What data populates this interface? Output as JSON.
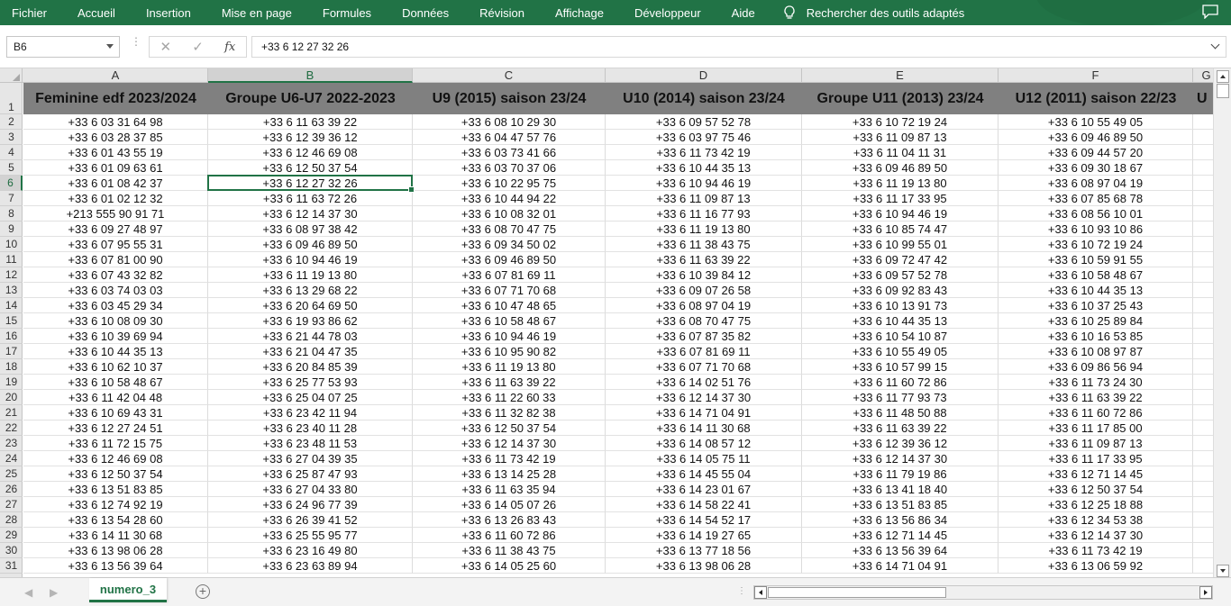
{
  "ribbon": {
    "tabs": [
      "Fichier",
      "Accueil",
      "Insertion",
      "Mise en page",
      "Formules",
      "Données",
      "Révision",
      "Affichage",
      "Développeur",
      "Aide"
    ],
    "search_label": "Rechercher des outils adaptés",
    "search_icon": "lightbulb-icon",
    "comment_icon": "comment-icon"
  },
  "formula_bar": {
    "name_box": "B6",
    "formula": "+33 6 12 27 32 26",
    "fx_label": "fx",
    "cancel_glyph": "✕",
    "enter_glyph": "✓"
  },
  "grid": {
    "column_letters": [
      "A",
      "B",
      "C",
      "D",
      "E",
      "F",
      "G"
    ],
    "selected_column": "B",
    "selected_row": 6,
    "row_numbers": [
      1,
      2,
      3,
      4,
      5,
      6,
      7,
      8,
      9,
      10,
      11,
      12,
      13,
      14,
      15,
      16,
      17,
      18,
      19,
      20,
      21,
      22,
      23,
      24,
      25,
      26,
      27,
      28,
      29,
      30,
      31
    ],
    "headers": [
      "Feminine edf 2023/2024",
      "Groupe U6-U7 2022-2023",
      "U9 (2015) saison 23/24",
      "U10 (2014) saison 23/24",
      "Groupe U11 (2013) 23/24",
      "U12 (2011) saison 22/23",
      "U"
    ],
    "rows": [
      [
        "+33 6 03 31 64 98",
        "+33 6 11 63 39 22",
        "+33 6 08 10 29 30",
        "+33 6 09 57 52 78",
        "+33 6 10 72 19 24",
        "+33 6 10 55 49 05"
      ],
      [
        "+33 6 03 28 37 85",
        "+33 6 12 39 36 12",
        "+33 6 04 47 57 76",
        "+33 6 03 97 75 46",
        "+33 6 11 09 87 13",
        "+33 6 09 46 89 50"
      ],
      [
        "+33 6 01 43 55 19",
        "+33 6 12 46 69 08",
        "+33 6 03 73 41 66",
        "+33 6 11 73 42 19",
        "+33 6 11 04 11 31",
        "+33 6 09 44 57 20"
      ],
      [
        "+33 6 01 09 63 61",
        "+33 6 12 50 37 54",
        "+33 6 03 70 37 06",
        "+33 6 10 44 35 13",
        "+33 6 09 46 89 50",
        "+33 6 09 30 18 67"
      ],
      [
        "+33 6 01 08 42 37",
        "+33 6 12 27 32 26",
        "+33 6 10 22 95 75",
        "+33 6 10 94 46 19",
        "+33 6 11 19 13 80",
        "+33 6 08 97 04 19"
      ],
      [
        "+33 6 01 02 12 32",
        "+33 6 11 63 72 26",
        "+33 6 10 44 94 22",
        "+33 6 11 09 87 13",
        "+33 6 11 17 33 95",
        "+33 6 07 85 68 78"
      ],
      [
        "+213 555 90 91 71",
        "+33 6 12 14 37 30",
        "+33 6 10 08 32 01",
        "+33 6 11 16 77 93",
        "+33 6 10 94 46 19",
        "+33 6 08 56 10 01"
      ],
      [
        "+33 6 09 27 48 97",
        "+33 6 08 97 38 42",
        "+33 6 08 70 47 75",
        "+33 6 11 19 13 80",
        "+33 6 10 85 74 47",
        "+33 6 10 93 10 86"
      ],
      [
        "+33 6 07 95 55 31",
        "+33 6 09 46 89 50",
        "+33 6 09 34 50 02",
        "+33 6 11 38 43 75",
        "+33 6 10 99 55 01",
        "+33 6 10 72 19 24"
      ],
      [
        "+33 6 07 81 00 90",
        "+33 6 10 94 46 19",
        "+33 6 09 46 89 50",
        "+33 6 11 63 39 22",
        "+33 6 09 72 47 42",
        "+33 6 10 59 91 55"
      ],
      [
        "+33 6 07 43 32 82",
        "+33 6 11 19 13 80",
        "+33 6 07 81 69 11",
        "+33 6 10 39 84 12",
        "+33 6 09 57 52 78",
        "+33 6 10 58 48 67"
      ],
      [
        "+33 6 03 74 03 03",
        "+33 6 13 29 68 22",
        "+33 6 07 71 70 68",
        "+33 6 09 07 26 58",
        "+33 6 09 92 83 43",
        "+33 6 10 44 35 13"
      ],
      [
        "+33 6 03 45 29 34",
        "+33 6 20 64 69 50",
        "+33 6 10 47 48 65",
        "+33 6 08 97 04 19",
        "+33 6 10 13 91 73",
        "+33 6 10 37 25 43"
      ],
      [
        "+33 6 10 08 09 30",
        "+33 6 19 93 86 62",
        "+33 6 10 58 48 67",
        "+33 6 08 70 47 75",
        "+33 6 10 44 35 13",
        "+33 6 10 25 89 84"
      ],
      [
        "+33 6 10 39 69 94",
        "+33 6 21 44 78 03",
        "+33 6 10 94 46 19",
        "+33 6 07 87 35 82",
        "+33 6 10 54 10 87",
        "+33 6 10 16 53 85"
      ],
      [
        "+33 6 10 44 35 13",
        "+33 6 21 04 47 35",
        "+33 6 10 95 90 82",
        "+33 6 07 81 69 11",
        "+33 6 10 55 49 05",
        "+33 6 10 08 97 87"
      ],
      [
        "+33 6 10 62 10 37",
        "+33 6 20 84 85 39",
        "+33 6 11 19 13 80",
        "+33 6 07 71 70 68",
        "+33 6 10 57 99 15",
        "+33 6 09 86 56 94"
      ],
      [
        "+33 6 10 58 48 67",
        "+33 6 25 77 53 93",
        "+33 6 11 63 39 22",
        "+33 6 14 02 51 76",
        "+33 6 11 60 72 86",
        "+33 6 11 73 24 30"
      ],
      [
        "+33 6 11 42 04 48",
        "+33 6 25 04 07 25",
        "+33 6 11 22 60 33",
        "+33 6 12 14 37 30",
        "+33 6 11 77 93 73",
        "+33 6 11 63 39 22"
      ],
      [
        "+33 6 10 69 43 31",
        "+33 6 23 42 11 94",
        "+33 6 11 32 82 38",
        "+33 6 14 71 04 91",
        "+33 6 11 48 50 88",
        "+33 6 11 60 72 86"
      ],
      [
        "+33 6 12 27 24 51",
        "+33 6 23 40 11 28",
        "+33 6 12 50 37 54",
        "+33 6 14 11 30 68",
        "+33 6 11 63 39 22",
        "+33 6 11 17 85 00"
      ],
      [
        "+33 6 11 72 15 75",
        "+33 6 23 48 11 53",
        "+33 6 12 14 37 30",
        "+33 6 14 08 57 12",
        "+33 6 12 39 36 12",
        "+33 6 11 09 87 13"
      ],
      [
        "+33 6 12 46 69 08",
        "+33 6 27 04 39 35",
        "+33 6 11 73 42 19",
        "+33 6 14 05 75 11",
        "+33 6 12 14 37 30",
        "+33 6 11 17 33 95"
      ],
      [
        "+33 6 12 50 37 54",
        "+33 6 25 87 47 93",
        "+33 6 13 14 25 28",
        "+33 6 14 45 55 04",
        "+33 6 11 79 19 86",
        "+33 6 12 71 14 45"
      ],
      [
        "+33 6 13 51 83 85",
        "+33 6 27 04 33 80",
        "+33 6 11 63 35 94",
        "+33 6 14 23 01 67",
        "+33 6 13 41 18 40",
        "+33 6 12 50 37 54"
      ],
      [
        "+33 6 12 74 92 19",
        "+33 6 24 96 77 39",
        "+33 6 14 05 07 26",
        "+33 6 14 58 22 41",
        "+33 6 13 51 83 85",
        "+33 6 12 25 18 88"
      ],
      [
        "+33 6 13 54 28 60",
        "+33 6 26 39 41 52",
        "+33 6 13 26 83 43",
        "+33 6 14 54 52 17",
        "+33 6 13 56 86 34",
        "+33 6 12 34 53 38"
      ],
      [
        "+33 6 14 11 30 68",
        "+33 6 25 55 95 77",
        "+33 6 11 60 72 86",
        "+33 6 14 19 27 65",
        "+33 6 12 71 14 45",
        "+33 6 12 14 37 30"
      ],
      [
        "+33 6 13 98 06 28",
        "+33 6 23 16 49 80",
        "+33 6 11 38 43 75",
        "+33 6 13 77 18 56",
        "+33 6 13 56 39 64",
        "+33 6 11 73 42 19"
      ],
      [
        "+33 6 13 56 39 64",
        "+33 6 23 63 89 94",
        "+33 6 14 05 25 60",
        "+33 6 13 98 06 28",
        "+33 6 14 71 04 91",
        "+33 6 13 06 59 92"
      ]
    ]
  },
  "sheets": {
    "tabs": [
      "numero_3"
    ],
    "active": "numero_3",
    "add_icon": "plus-circle-icon"
  },
  "colors": {
    "accent": "#217346",
    "header_fill": "#808080"
  }
}
